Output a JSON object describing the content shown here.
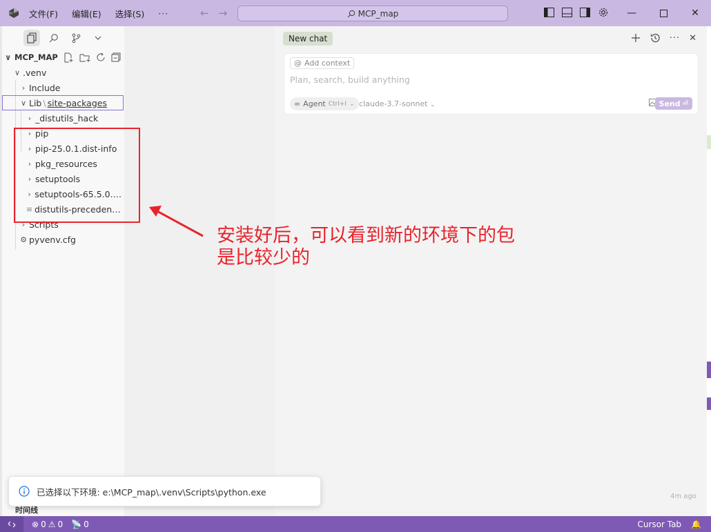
{
  "titlebar": {
    "menus": [
      "文件(F)",
      "编辑(E)",
      "选择(S)"
    ],
    "more": "···",
    "search_text": "MCP_map"
  },
  "explorer": {
    "root": "MCP_MAP",
    "tree": {
      "venv": ".venv",
      "include": "Include",
      "lib": "Lib",
      "lib_sep": "\\",
      "site_packages": "site-packages",
      "distutils_hack": "_distutils_hack",
      "pip": "pip",
      "pip_dist": "pip-25.0.1.dist-info",
      "pkg_resources": "pkg_resources",
      "setuptools": "setuptools",
      "setuptools_dist": "setuptools-65.5.0.di...",
      "distutils_pth": "distutils-precedence...",
      "scripts": "Scripts",
      "pyvenv": "pyvenv.cfg"
    },
    "timeline": "时间线"
  },
  "chat": {
    "tab": "New chat",
    "add_context": "Add context",
    "placeholder": "Plan, search, build anything",
    "agent": "Agent",
    "agent_shortcut": "Ctrl+I",
    "model": "claude-3.7-sonnet",
    "send": "Send",
    "ago": "4m ago"
  },
  "toast": {
    "message": "已选择以下环境: e:\\MCP_map\\.venv\\Scripts\\python.exe"
  },
  "statusbar": {
    "errors": "0",
    "warnings": "0",
    "ports": "0",
    "cursor_tab": "Cursor Tab"
  },
  "annotation": {
    "line1": "安装好后，可以看到新的环境下的包",
    "line2": "是比较少的"
  },
  "colors": {
    "titlebar": "#c9b9e2",
    "statusbar": "#7e5ab5",
    "annotation": "#e8232c"
  }
}
